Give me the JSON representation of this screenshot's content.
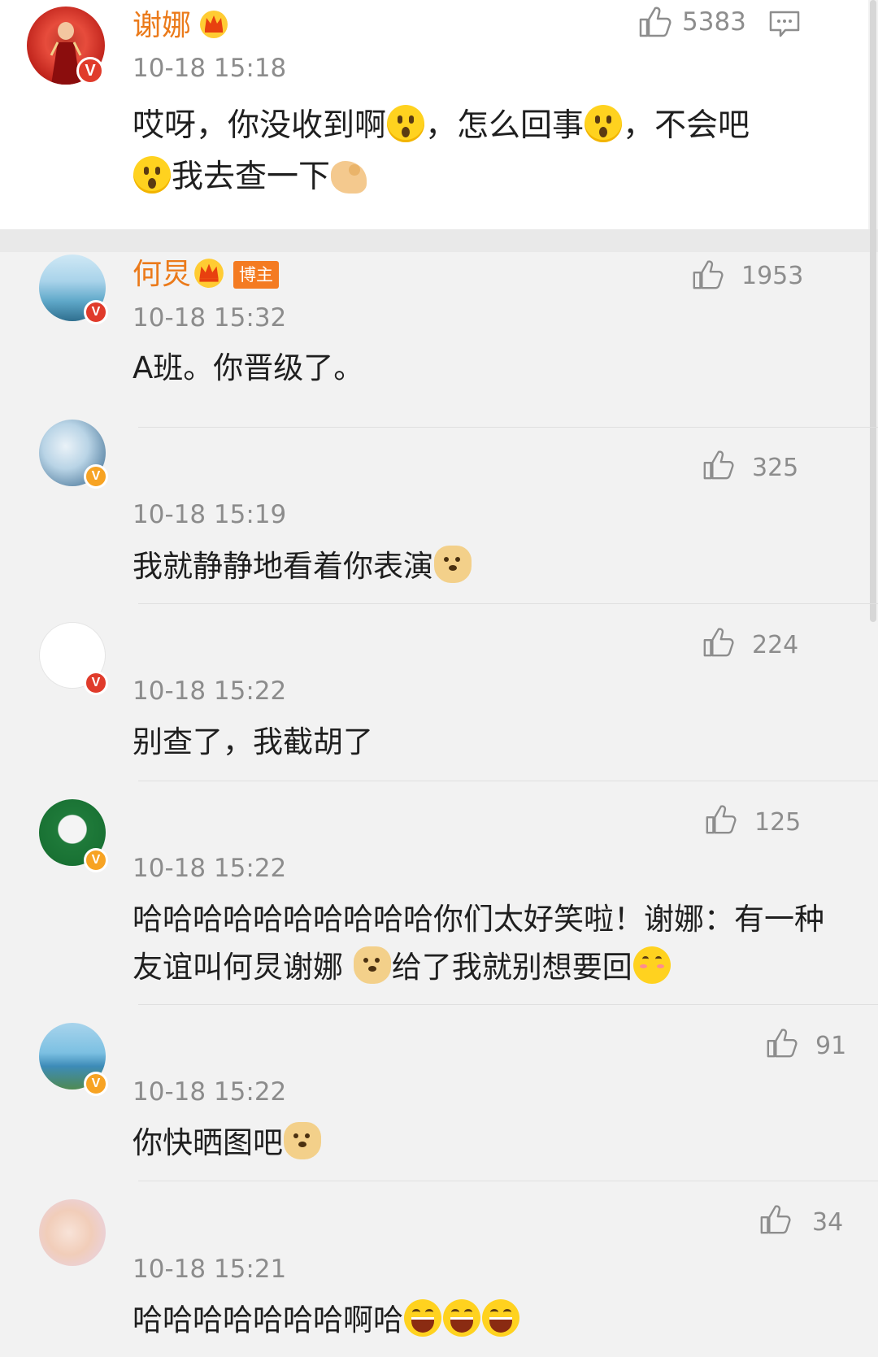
{
  "main_comment": {
    "name": "谢娜",
    "time": "10-18 15:18",
    "likes": "5383",
    "text_segments": [
      "哎呀，你没收到啊",
      "，怎么回事",
      "，不会吧",
      "我去查一下"
    ],
    "icons": [
      "like-icon",
      "reply-icon",
      "crown-icon",
      "verified-badge"
    ]
  },
  "replies": [
    {
      "name": "何炅",
      "tag": "博主",
      "time": "10-18 15:32",
      "likes": "1953",
      "text": "A班。你晋级了。"
    },
    {
      "name": "",
      "time": "10-18 15:19",
      "likes": "325",
      "text": "我就静静地看着你表演"
    },
    {
      "name": "",
      "time": "10-18 15:22",
      "likes": "224",
      "text": "别查了，我截胡了"
    },
    {
      "name": "",
      "time": "10-18 15:22",
      "likes": "125",
      "text_line1": "哈哈哈哈哈哈哈哈哈哈你们太好笑啦！谢娜：有一种",
      "text_line2a": "友谊叫何炅谢娜 ",
      "text_line2b": "给了我就别想要回"
    },
    {
      "name": "",
      "time": "10-18 15:22",
      "likes": "91",
      "text": "你快晒图吧"
    },
    {
      "name": "",
      "time": "10-18 15:21",
      "likes": "34",
      "text": "哈哈哈哈哈哈哈啊哈"
    }
  ],
  "colors": {
    "name": "#eb7a1a",
    "tag_bg": "#f47b22",
    "verified_gold": "#f7a323",
    "verified_red": "#e03b2b",
    "background": "#f2f2f2"
  }
}
